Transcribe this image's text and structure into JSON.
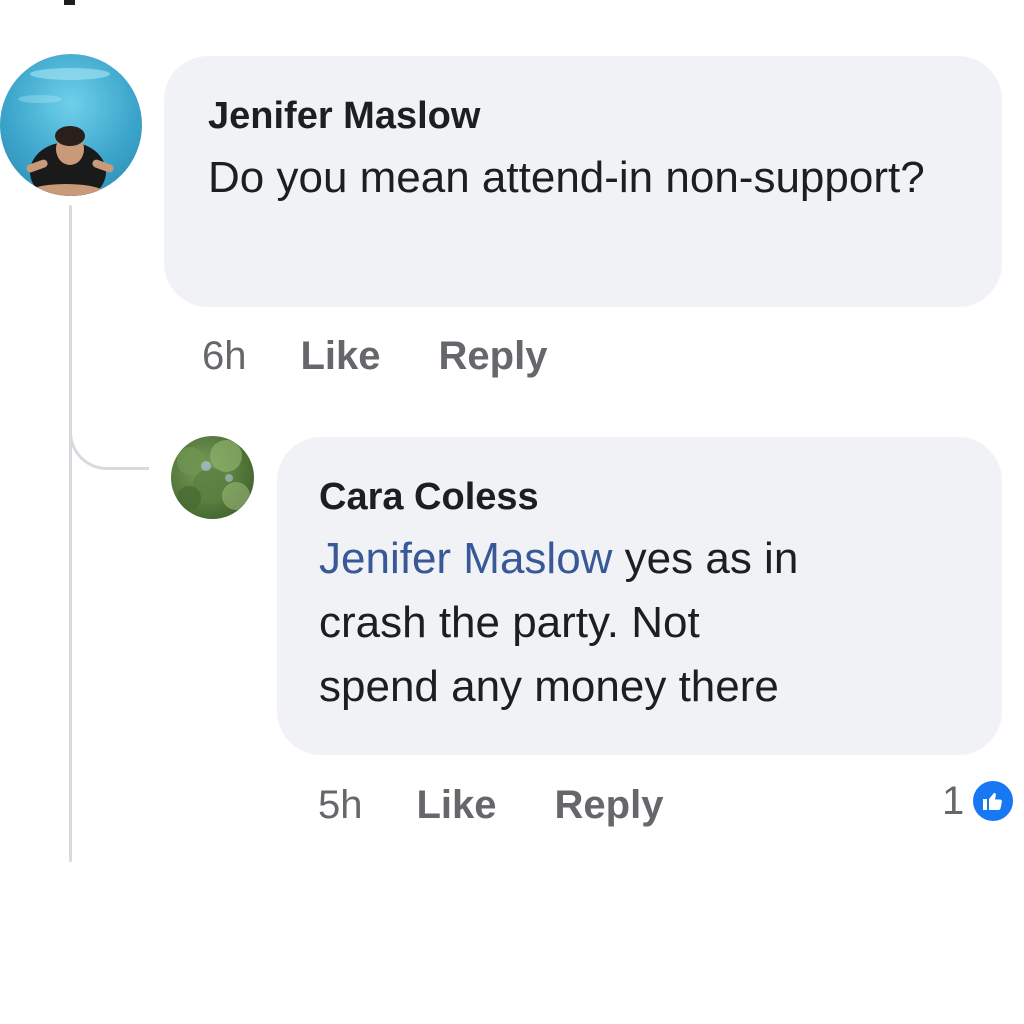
{
  "comments": [
    {
      "author": "Jenifer Maslow",
      "text": "Do you mean attend-in non-support?",
      "time": "6h",
      "like_label": "Like",
      "reply_label": "Reply"
    },
    {
      "author": "Cara Coless",
      "mention": "Jenifer Maslow",
      "text_line1_rest": " yes as in",
      "text_line2": "crash the party. Not",
      "text_line3": "spend any money there",
      "time": "5h",
      "like_label": "Like",
      "reply_label": "Reply",
      "reaction_count": "1",
      "reaction_icon": "like-icon"
    }
  ],
  "colors": {
    "bubble": "#f0f2f5",
    "mention": "#385898",
    "meta": "#65676b",
    "like_badge": "#1877f2"
  }
}
